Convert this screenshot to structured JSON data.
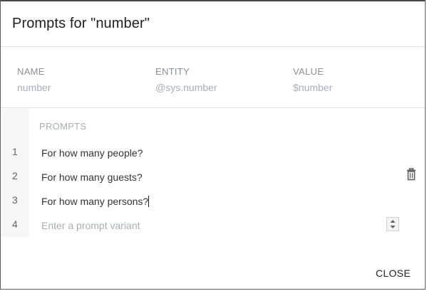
{
  "dialog": {
    "title": "Prompts for \"number\""
  },
  "parameter": {
    "name_header": "NAME",
    "name_value": "number",
    "entity_header": "ENTITY",
    "entity_value": "@sys.number",
    "value_header": "VALUE",
    "value_value": "$number"
  },
  "prompts": {
    "header": "PROMPTS",
    "rows": [
      {
        "number": "1",
        "text": "For how many people?"
      },
      {
        "number": "2",
        "text": "For how many guests?"
      },
      {
        "number": "3",
        "text": "For how many persons?"
      },
      {
        "number": "4",
        "placeholder": "Enter a prompt variant"
      }
    ]
  },
  "icons": {
    "delete": "trash-icon",
    "stepper": "stepper-arrows-icon"
  },
  "colors": {
    "title_text": "#202124",
    "muted_text": "#a9adb3",
    "header_text": "#8a8f98",
    "gutter_bg": "#f6f6f6"
  },
  "footer": {
    "close_label": "CLOSE"
  }
}
